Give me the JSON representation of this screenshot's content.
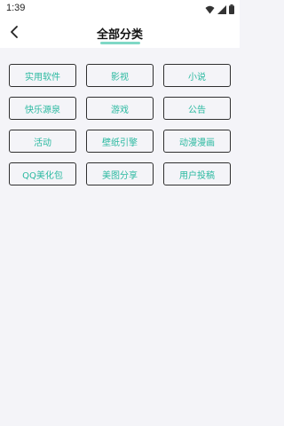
{
  "status_bar": {
    "time": "1:39"
  },
  "header": {
    "title": "全部分类"
  },
  "categories": [
    "实用软件",
    "影视",
    "小说",
    "快乐源泉",
    "游戏",
    "公告",
    "活动",
    "壁纸引擎",
    "动漫漫画",
    "QQ美化包",
    "美图分享",
    "用户投稿"
  ],
  "colors": {
    "accent": "#2ab9a0",
    "underline": "#7fd8c6",
    "border": "#2f2f2f",
    "background": "#f4f4f8"
  },
  "icons": [
    "wifi-icon",
    "signal-icon",
    "battery-icon",
    "chevron-left-icon"
  ]
}
